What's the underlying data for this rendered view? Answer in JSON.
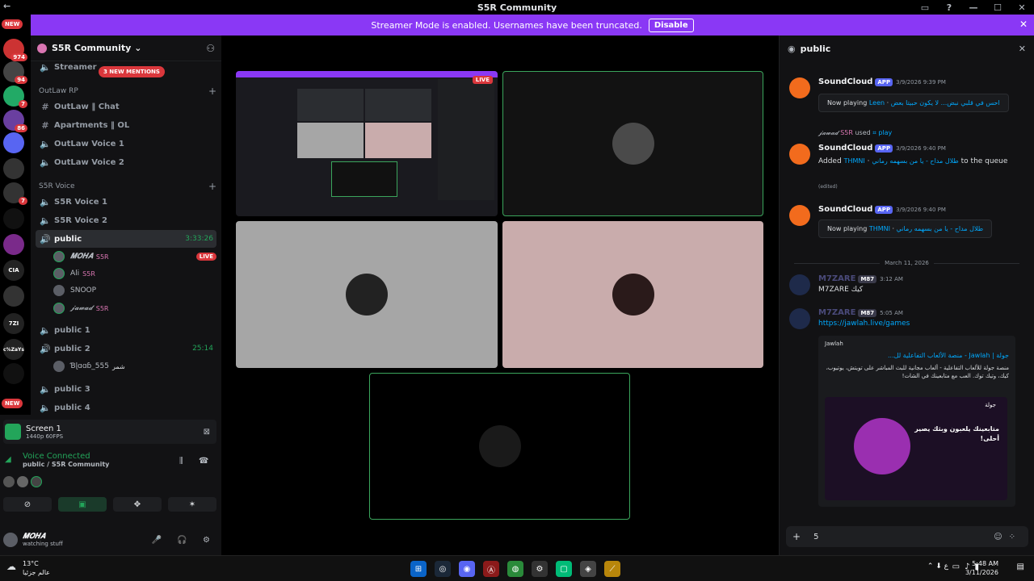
{
  "titlebar": {
    "title": "S5R Community",
    "back": "←"
  },
  "banner": {
    "text": "Streamer Mode is enabled. Usernames have been truncated.",
    "button": "Disable",
    "close": "✕"
  },
  "rail": {
    "new_top": "NEW",
    "new_bottom": "NEW",
    "badges": [
      "974",
      "94",
      "7",
      "86",
      "7"
    ],
    "icons": [
      "CIA",
      "c%ZaYs",
      "7ZI"
    ]
  },
  "server": {
    "name": "S5R Community",
    "mention_pill": "3 NEW MENTIONS"
  },
  "channels": [
    {
      "name": "Streamer",
      "type": "voice"
    },
    {
      "category": "OutLaw RP"
    },
    {
      "name": "OutLaw ‖ Chat",
      "type": "text"
    },
    {
      "name": "Apartments ‖ OL",
      "type": "text"
    },
    {
      "name": "OutLaw Voice 1",
      "type": "voice"
    },
    {
      "name": "OutLaw Voice 2",
      "type": "voice"
    },
    {
      "category": "S5R Voice"
    },
    {
      "name": "S5R Voice 1",
      "type": "voice"
    },
    {
      "name": "S5R Voice 2",
      "type": "voice"
    },
    {
      "name": "public",
      "type": "voice",
      "time": "3:33:26"
    },
    {
      "name": "public 1",
      "type": "voice"
    },
    {
      "name": "public 2",
      "type": "voice",
      "time": "25:14"
    },
    {
      "name": "public 3",
      "type": "voice"
    },
    {
      "name": "public 4",
      "type": "voice"
    }
  ],
  "voice_users": [
    {
      "name": "𝑴𝑶𝑯𝑨",
      "tag": "S5R",
      "live": "LIVE"
    },
    {
      "name": "Ali",
      "tag": "S5R"
    },
    {
      "name": "SNOOP",
      "tag": ""
    },
    {
      "name": "𝓳𝓪𝔀𝓪𝓭",
      "tag": "S5R"
    }
  ],
  "voice_users_public2": [
    {
      "name": "Ɓɭɑɑɓ_555",
      "tag": "شمر"
    }
  ],
  "screen_share": {
    "title": "Screen 1",
    "sub": "1440p 60FPS"
  },
  "voice_status": {
    "title": "Voice Connected",
    "sub": "public / S5R Community"
  },
  "controls": [
    "⊘",
    "▣",
    "✥",
    "✶"
  ],
  "user": {
    "name": "𝑴𝑶𝑯𝑨",
    "status": "watching stuff",
    "icons": "🎤 🎧 ⚙"
  },
  "stream_live": "LIVE",
  "chat": {
    "channel": "public",
    "messages": [
      {
        "author": "SoundCloud",
        "app": "APP",
        "time": "3/9/2026 9:39 PM",
        "embed": "Now playing",
        "embed_link": "Leen",
        "embed_tail": "احس في قلبي نبض... لا يكون حبيتا بعض"
      },
      {
        "reply_user": "𝓳𝓪𝔀𝓪𝓭",
        "reply_tag": "S5R",
        "reply_text": "used",
        "reply_cmd": "⌗ play",
        "author": "SoundCloud",
        "app": "APP",
        "time": "3/9/2026 9:40 PM",
        "body_pre": "Added",
        "body_link": "THMNI",
        "body_tail": "طلال مداح - يا من بسهمه رماني",
        "body_end": "to the queue",
        "edited": "(edited)"
      },
      {
        "author": "SoundCloud",
        "app": "APP",
        "time": "3/9/2026 9:40 PM",
        "embed": "Now playing",
        "embed_link": "THMNI",
        "embed_tail": "طلال مداح - يا من بسهمه رماني"
      }
    ],
    "divider": "March 11, 2026",
    "m7": [
      {
        "author": "M7ZARE",
        "tag": "M87",
        "time": "3:12 AM",
        "body": "M7ZARE كيك"
      },
      {
        "author": "M7ZARE",
        "tag": "M87",
        "time": "5:05 AM",
        "link": "https://jawlah.live/games"
      }
    ],
    "rich": {
      "provider": "Jawlah",
      "title": "جولة | Jawlah - منصة الألعاب التفاعلية لل...",
      "desc": "منصة جولة للألعاب التفاعلية - ألعاب مجانية للبث المباشر على تويتش، يوتيوب، كيك، وتيك توك. العب مع متابعينك في الشات!",
      "img_text": "متابعينك يلعبون وبثك يصير أحلى!",
      "img_tag": "جولة"
    },
    "input": "5"
  },
  "taskbar": {
    "temp": "13°C",
    "place": "عالم جزئيا",
    "time": "5:48 AM",
    "date": "3/11/2026",
    "lang": "ع"
  },
  "colors": {
    "accent": "#8a38f5",
    "green": "#23a55a",
    "red": "#da373c",
    "link": "#00a8fc",
    "pink_tile": "#c9acac",
    "grey_tile": "#a6a6a6"
  }
}
